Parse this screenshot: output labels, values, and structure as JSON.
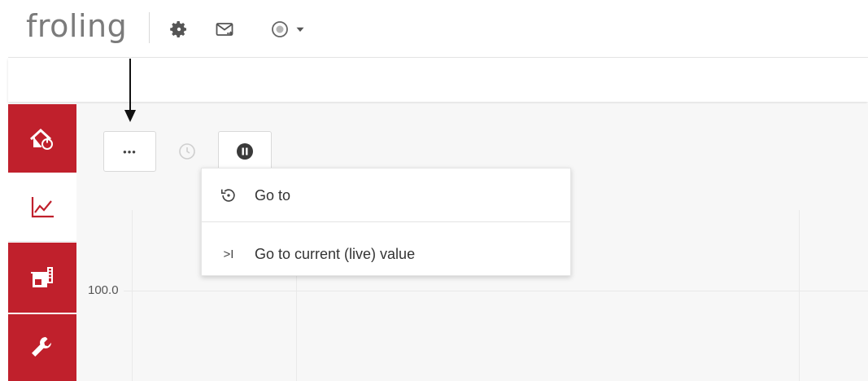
{
  "header": {
    "logo_text": "froling",
    "icons": [
      "gear-icon",
      "mail-icon",
      "status-circle-icon",
      "caret-down-icon"
    ]
  },
  "sidebar": {
    "items": [
      {
        "icon": "home-power-icon",
        "active": false
      },
      {
        "icon": "chart-line-icon",
        "active": true
      },
      {
        "icon": "boiler-icon",
        "active": false
      },
      {
        "icon": "wrench-icon",
        "active": false
      }
    ],
    "colors": {
      "accent": "#c0202c",
      "active_bg": "#ffffff"
    }
  },
  "toolbar": {
    "more_label": "•••",
    "buttons": [
      "more-options-button",
      "history-clock-button",
      "pause-button"
    ]
  },
  "chart": {
    "y_tick": "100.0"
  },
  "menu": {
    "items": [
      {
        "icon": "goto-history-icon",
        "label": "Go to"
      },
      {
        "icon_text": ">I",
        "label": "Go to current (live) value"
      }
    ]
  }
}
